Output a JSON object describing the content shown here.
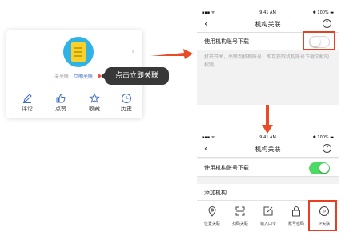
{
  "colors": {
    "accent_red": "#ea3e23",
    "toggle_on": "#4cd964",
    "link_blue": "#3d6cc4",
    "tooltip_bg": "#383838"
  },
  "profile_card": {
    "avatar_icon": "document-avatar-icon",
    "status_text": "未关联",
    "link_text": "立即关联",
    "actions": [
      {
        "label": "评论",
        "icon": "pencil-icon"
      },
      {
        "label": "点赞",
        "icon": "thumbs-up-icon"
      },
      {
        "label": "收藏",
        "icon": "star-icon"
      },
      {
        "label": "历史",
        "icon": "clock-icon"
      }
    ]
  },
  "tooltip": {
    "text": "点击立即关联"
  },
  "phone_top": {
    "status_bar": {
      "signal": "▪▪▪ ᯤ",
      "time": "9:41 AM",
      "battery": "✱ 100% ▬"
    },
    "nav": {
      "back": "‹",
      "title": "机构关联",
      "help": "?"
    },
    "toggle_row": {
      "label": "使用机构账号下载",
      "state": "off"
    },
    "description": "打开开关，关联到机构账号，即可获取机构账号下载文献的权限。"
  },
  "phone_bottom": {
    "status_bar": {
      "signal": "▪▪▪ ᯤ",
      "time": "9:41 AM",
      "battery": "✱ 100% ▬"
    },
    "nav": {
      "back": "‹",
      "title": "机构关联",
      "help": "?"
    },
    "toggle_row": {
      "label": "使用机构账号下载",
      "state": "on"
    },
    "section_title": "添加机构",
    "options": [
      {
        "label": "位置关联",
        "icon": "location-pin-icon"
      },
      {
        "label": "扫码关联",
        "icon": "scan-icon"
      },
      {
        "label": "输入口令",
        "icon": "edit-box-icon"
      },
      {
        "label": "账号密码",
        "icon": "lock-icon"
      },
      {
        "label": "IP关联",
        "icon": "ip-icon"
      }
    ]
  }
}
